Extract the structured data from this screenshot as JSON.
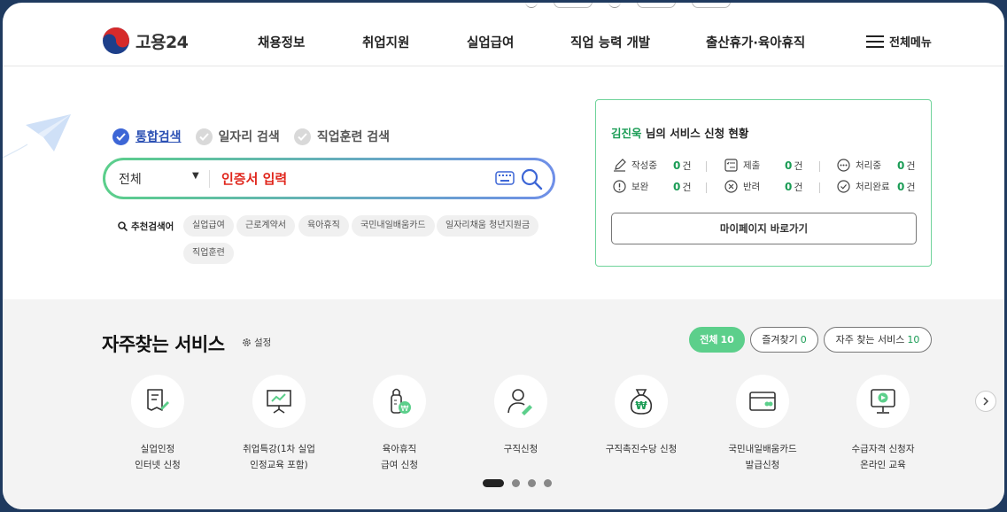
{
  "header": {
    "logo_text": "고용24",
    "nav": [
      "채용정보",
      "취업지원",
      "실업급여",
      "직업 능력 개발",
      "출산휴가·육아휴직"
    ],
    "menu_label": "전체메뉴"
  },
  "search": {
    "tabs": [
      "통합검색",
      "일자리 검색",
      "직업훈련 검색"
    ],
    "scope": "전체",
    "input_value": "인증서 입력",
    "recommend_label": "추천검색어",
    "chips": [
      "실업급여",
      "근로계약서",
      "육아휴직",
      "국민내일배움카드",
      "일자리채움 청년지원금",
      "직업훈련"
    ]
  },
  "status": {
    "user_name": "김진욱",
    "title_suffix": "님의 서비스 신청 현황",
    "items": [
      {
        "label": "작성중",
        "count": "0",
        "unit": "건"
      },
      {
        "label": "제출",
        "count": "0",
        "unit": "건"
      },
      {
        "label": "처리중",
        "count": "0",
        "unit": "건"
      },
      {
        "label": "보완",
        "count": "0",
        "unit": "건"
      },
      {
        "label": "반려",
        "count": "0",
        "unit": "건"
      },
      {
        "label": "처리완료",
        "count": "0",
        "unit": "건"
      }
    ],
    "mypage_button": "마이페이지 바로가기"
  },
  "frequent": {
    "title": "자주찾는 서비스",
    "setting_label": "설정",
    "tabs": [
      {
        "label": "전체",
        "count": "10"
      },
      {
        "label": "즐겨찾기",
        "count": "0"
      },
      {
        "label": "자주 찾는 서비스",
        "count": "10"
      }
    ],
    "services": [
      {
        "label": "실업인정\n인터넷 신청",
        "icon": "document-edit-icon"
      },
      {
        "label": "취업특강(1차 실업\n인정교육 포함)",
        "icon": "presentation-board-icon"
      },
      {
        "label": "육아휴직\n급여 신청",
        "icon": "baby-bottle-icon"
      },
      {
        "label": "구직신청",
        "icon": "person-edit-icon"
      },
      {
        "label": "구직촉진수당 신청",
        "icon": "money-bag-icon"
      },
      {
        "label": "국민내일배움카드\n발급신청",
        "icon": "card-icon"
      },
      {
        "label": "수급자격 신청자\n온라인 교육",
        "icon": "monitor-play-icon"
      }
    ]
  },
  "colors": {
    "accent_green": "#5ccf8b",
    "accent_blue": "#3d66d6",
    "alert_red": "#e0261c"
  }
}
